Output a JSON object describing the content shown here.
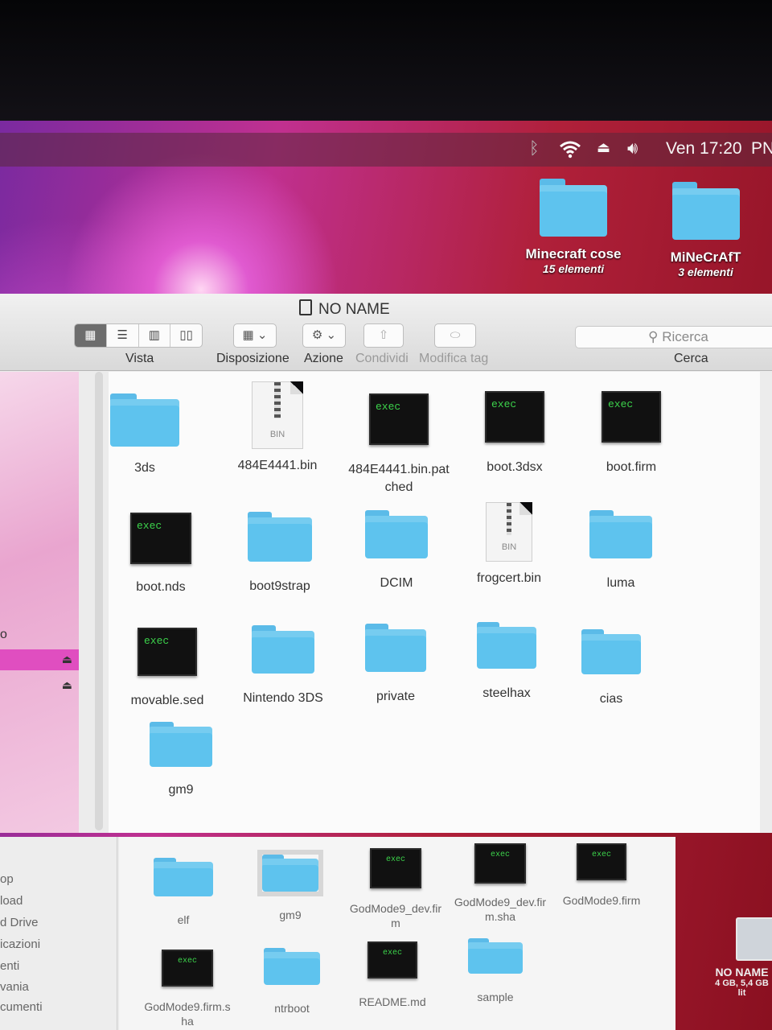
{
  "menubar": {
    "datetime": "Ven 17:20",
    "user_initials": "PN"
  },
  "desktop": {
    "icons": [
      {
        "label": "Minecraft cose",
        "sub": "15 elementi"
      },
      {
        "label": "MiNeCrAfT",
        "sub": "3 elementi"
      }
    ],
    "drive": {
      "label": "NO NAME",
      "sub": "4 GB, 5,4 GB lit"
    }
  },
  "window": {
    "title": "NO NAME",
    "toolbar": {
      "vista": "Vista",
      "disposizione": "Disposizione",
      "azione": "Azione",
      "condividi": "Condividi",
      "modifica_tag": "Modifica tag",
      "search_placeholder": "Ricerca",
      "cerca": "Cerca"
    },
    "sidebar": {
      "partial_label": "o"
    },
    "files": [
      {
        "name": "3ds",
        "type": "folder"
      },
      {
        "name": "484E4441.bin",
        "type": "bin",
        "ext": "BIN"
      },
      {
        "name": "484E4441.bin.patched",
        "type": "exec",
        "line1": "484E4441.bin.pat",
        "line2": "ched",
        "badge": "exec"
      },
      {
        "name": "boot.3dsx",
        "type": "exec",
        "badge": "exec"
      },
      {
        "name": "boot.firm",
        "type": "exec",
        "badge": "exec"
      },
      {
        "name": "boot.nds",
        "type": "exec",
        "badge": "exec"
      },
      {
        "name": "boot9strap",
        "type": "folder"
      },
      {
        "name": "DCIM",
        "type": "folder"
      },
      {
        "name": "frogcert.bin",
        "type": "bin",
        "ext": "BIN"
      },
      {
        "name": "luma",
        "type": "folder"
      },
      {
        "name": "movable.sed",
        "type": "exec",
        "badge": "exec"
      },
      {
        "name": "Nintendo 3DS",
        "type": "folder"
      },
      {
        "name": "private",
        "type": "folder"
      },
      {
        "name": "steelhax",
        "type": "folder"
      },
      {
        "name": "cias",
        "type": "folder"
      },
      {
        "name": "gm9",
        "type": "folder"
      }
    ]
  },
  "back_window": {
    "sidebar": [
      "op",
      "load",
      "d Drive",
      "icazioni",
      "enti",
      "vania",
      "cumenti"
    ],
    "files": [
      {
        "name": "elf",
        "type": "folder"
      },
      {
        "name": "gm9",
        "type": "folder"
      },
      {
        "line1": "GodMode9_dev.fir",
        "line2": "m",
        "type": "exec",
        "badge": "exec"
      },
      {
        "line1": "GodMode9_dev.fir",
        "line2": "m.sha",
        "type": "exec",
        "badge": "exec"
      },
      {
        "name": "GodMode9.firm",
        "type": "exec",
        "badge": "exec"
      },
      {
        "line1": "GodMode9.firm.s",
        "line2": "ha",
        "type": "exec",
        "badge": "exec"
      },
      {
        "name": "ntrboot",
        "type": "folder"
      },
      {
        "name": "README.md",
        "type": "exec",
        "badge": "exec"
      },
      {
        "name": "sample",
        "type": "folder"
      }
    ]
  }
}
